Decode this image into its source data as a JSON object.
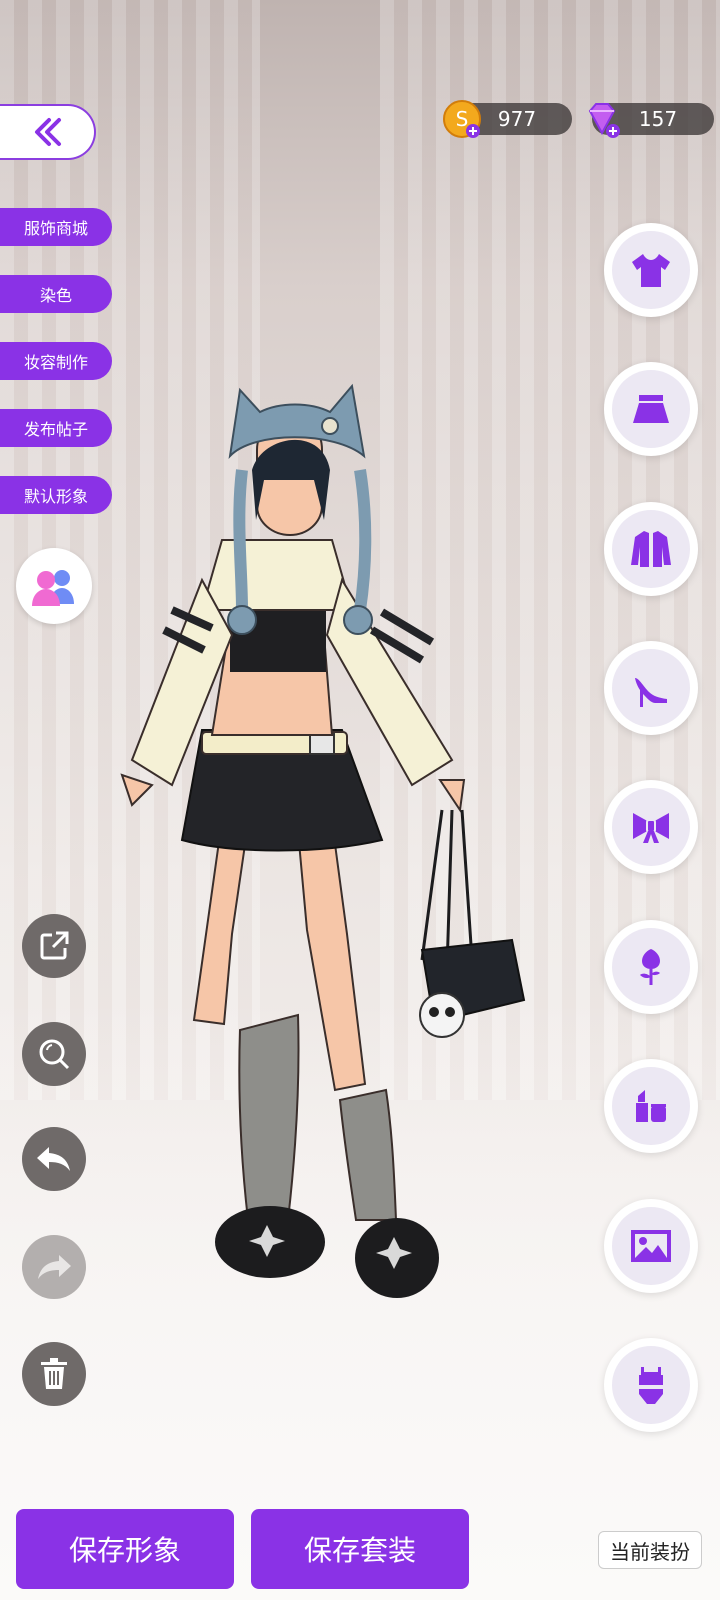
{
  "currency": {
    "coins": "977",
    "gems": "157"
  },
  "side_menu": [
    "服饰商城",
    "染色",
    "妆容制作",
    "发布帖子",
    "默认形象"
  ],
  "bottom": {
    "save_look": "保存形象",
    "save_outfit": "保存套装",
    "current_outfit": "当前装扮"
  },
  "categories": [
    "top-icon",
    "skirt-icon",
    "jacket-icon",
    "heels-icon",
    "bow-icon",
    "rose-icon",
    "makeup-icon",
    "background-icon",
    "set-icon"
  ],
  "tools": [
    "share-icon",
    "zoom-icon",
    "undo-icon",
    "redo-icon",
    "trash-icon"
  ],
  "colors": {
    "accent": "#8a32e6",
    "tool": "#6f6a69"
  }
}
